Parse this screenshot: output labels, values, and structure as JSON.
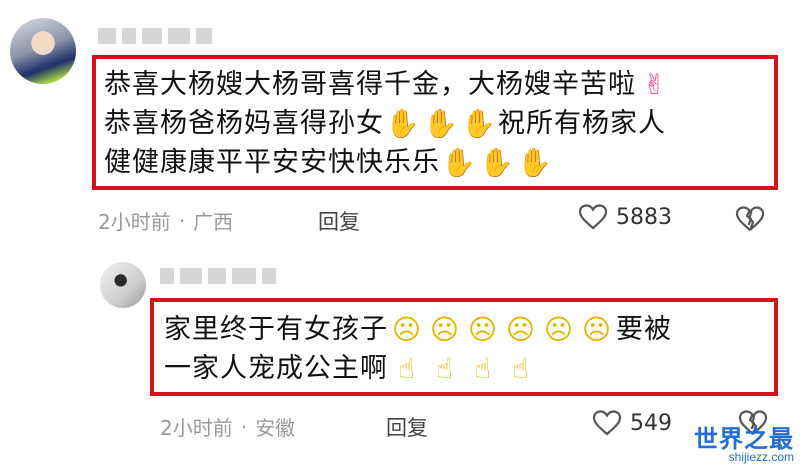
{
  "comments": [
    {
      "lines": [
        [
          "恭喜大杨嫂大杨哥喜得千金，大杨嫂辛苦啦",
          "hearthand"
        ],
        [
          "恭喜杨爸杨妈喜得孙女",
          "clap",
          "clap",
          "clap",
          "祝所有杨家人"
        ],
        [
          "健健康康平平安安快快乐乐",
          "clap",
          "clap",
          "clap"
        ]
      ],
      "time": "2小时前",
      "location": "广西",
      "reply": "回复",
      "likes": "5883"
    },
    {
      "lines": [
        [
          "家里终于有女孩子",
          "cry",
          "cry",
          "cry",
          "cry",
          "cry",
          "cry",
          "要被"
        ],
        [
          "一家人宠成公主啊",
          "thumb",
          "thumb",
          "thumb",
          "thumb"
        ]
      ],
      "time": "2小时前",
      "location": "安徽",
      "reply": "回复",
      "likes": "549"
    }
  ],
  "watermark": {
    "title": "世界之最",
    "url": "shijiezz.com"
  },
  "icons": {
    "clap": "clapping-hands-icon",
    "cry": "crying-face-icon",
    "thumb": "thumbs-up-icon",
    "hearthand": "hand-with-heart-icon",
    "like": "heart-outline-icon",
    "dislike": "broken-heart-icon"
  },
  "colors": {
    "highlight_border": "#d4121e",
    "watermark": "#1f6fd6"
  }
}
